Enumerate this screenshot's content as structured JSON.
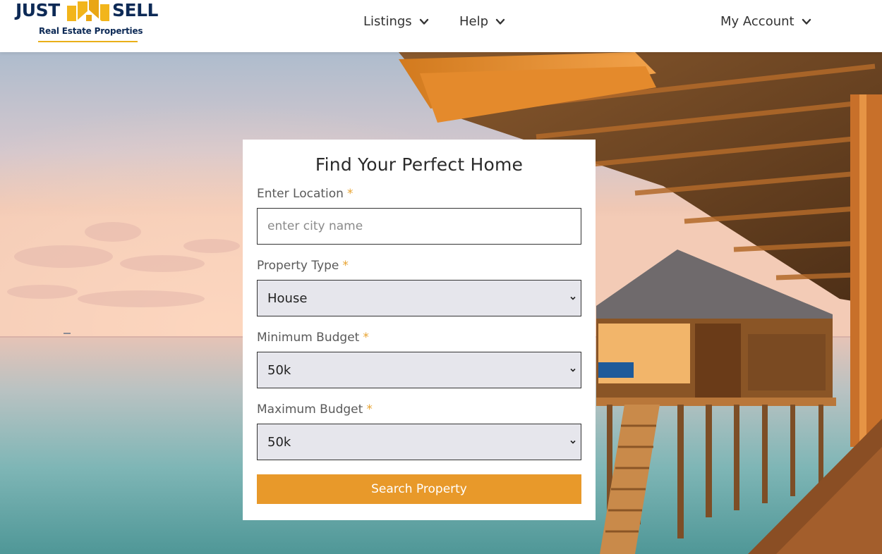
{
  "brand": {
    "name_left": "JUST",
    "name_right": "SELL",
    "tagline": "Real Estate Properties",
    "colors": {
      "navy": "#0d2a56",
      "gold": "#e9b018"
    }
  },
  "nav": {
    "items": [
      {
        "label": "Listings",
        "icon": "chevron-down-icon"
      },
      {
        "label": "Help",
        "icon": "chevron-down-icon"
      },
      {
        "label": "My Account",
        "icon": "chevron-down-icon"
      }
    ]
  },
  "search_form": {
    "title": "Find Your Perfect Home",
    "required_mark": "*",
    "location": {
      "label": "Enter Location",
      "placeholder": "enter city name",
      "value": ""
    },
    "property_type": {
      "label": "Property Type",
      "selected": "House"
    },
    "min_budget": {
      "label": "Minimum Budget",
      "selected": "50k"
    },
    "max_budget": {
      "label": "Maximum Budget",
      "selected": "50k"
    },
    "submit_label": "Search Property",
    "colors": {
      "accent": "#e8992a",
      "required": "#e8a432",
      "select_bg": "#e6e6ec"
    }
  }
}
